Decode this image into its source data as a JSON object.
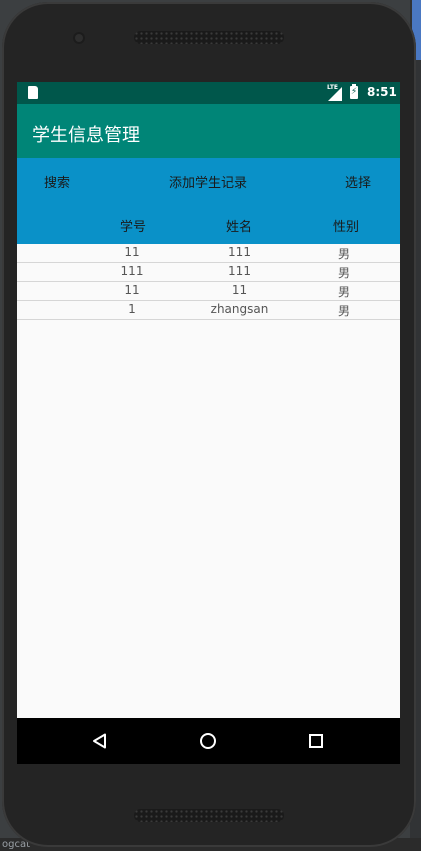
{
  "status_bar": {
    "time": "8:51",
    "network": "LTE"
  },
  "app_bar": {
    "title": "学生信息管理"
  },
  "actions": {
    "search": "搜索",
    "add": "添加学生记录",
    "select": "选择"
  },
  "table": {
    "headers": [
      "学号",
      "姓名",
      "性别"
    ],
    "rows": [
      [
        "11",
        "111",
        "男"
      ],
      [
        "111",
        "111",
        "男"
      ],
      [
        "11",
        "11",
        "男"
      ],
      [
        "1",
        "zhangsan",
        "男"
      ]
    ]
  },
  "ide": {
    "tab_label": "ogcat"
  }
}
